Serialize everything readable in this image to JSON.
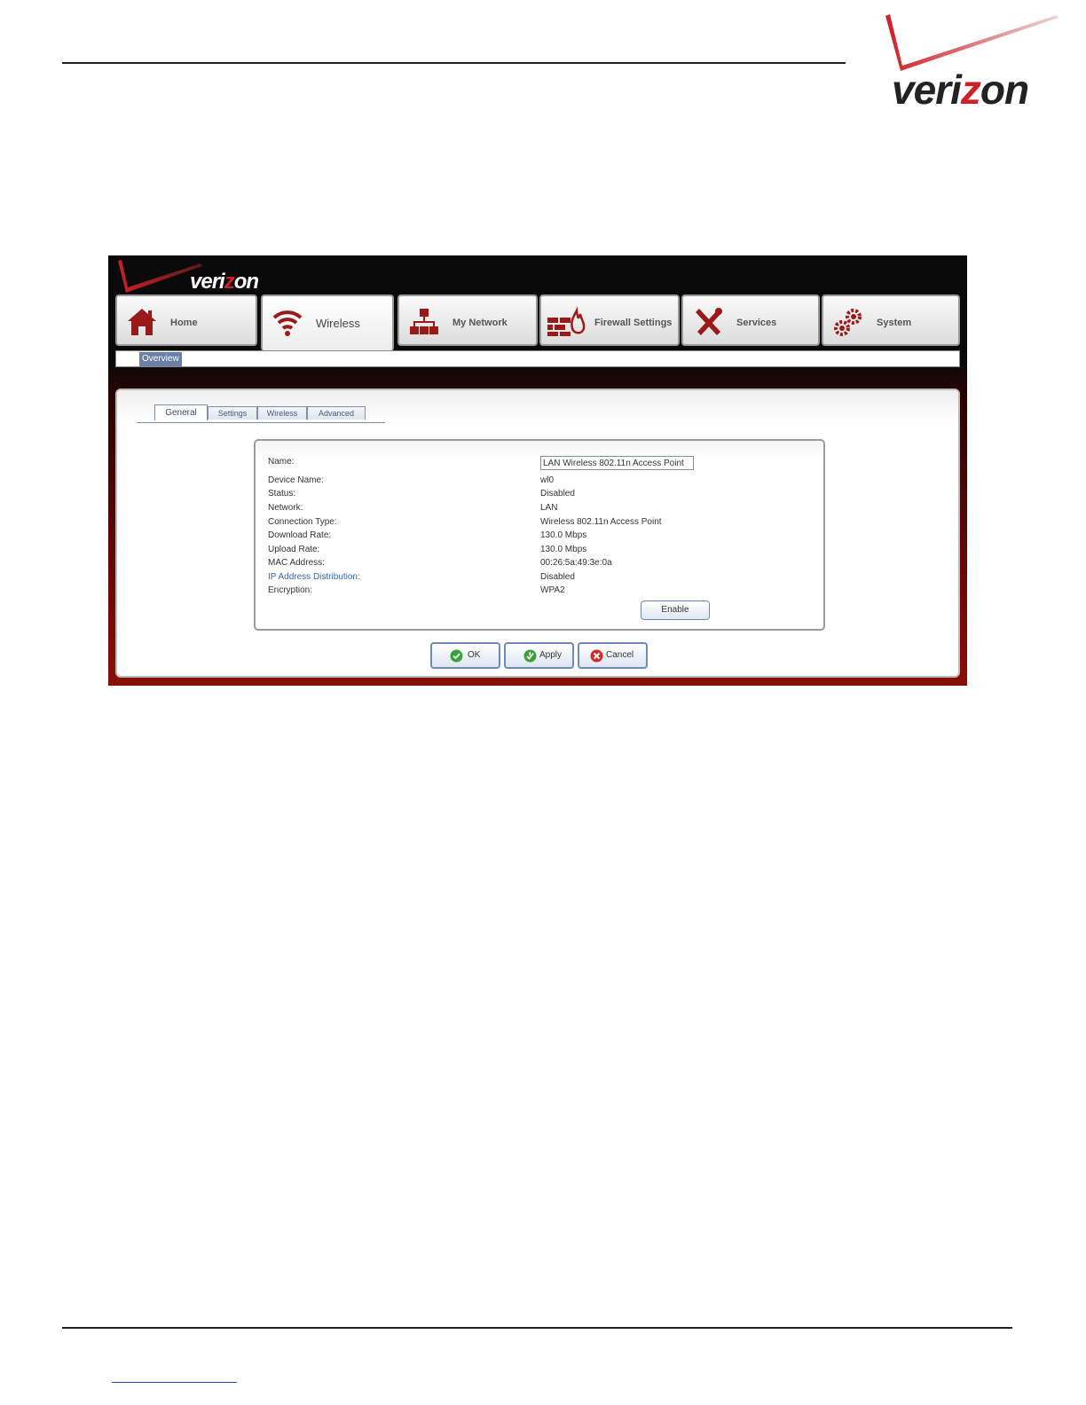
{
  "brand": {
    "name": "verizon",
    "parts": [
      "veri",
      "z",
      "on"
    ],
    "accent": "#cd2027",
    "dark": "#222222"
  },
  "app": {
    "logo_parts": [
      "veri",
      "z",
      "on"
    ],
    "nav": [
      {
        "label": "Home",
        "icon": "home-icon",
        "active": false
      },
      {
        "label": "Wireless",
        "icon": "wifi-icon",
        "active": true
      },
      {
        "label": "My Network",
        "icon": "network-icon",
        "active": false
      },
      {
        "label": "Firewall Settings",
        "icon": "firewall-icon",
        "active": false
      },
      {
        "label": "Services",
        "icon": "tools-icon",
        "active": false
      },
      {
        "label": "System",
        "icon": "gears-icon",
        "active": false
      }
    ],
    "subnav": {
      "overview": "Overview"
    },
    "tabs": {
      "general": "General",
      "settings": "Settings",
      "wireless": "Wireless",
      "advanced": "Advanced",
      "active": "General"
    },
    "info": {
      "name_label": "Name:",
      "name_value": "LAN Wireless 802.11n Access Point",
      "rows": [
        {
          "key": "Device Name:",
          "value": "wl0"
        },
        {
          "key": "Status:",
          "value": "Disabled"
        },
        {
          "key": "Network:",
          "value": "LAN"
        },
        {
          "key": "Connection Type:",
          "value": "Wireless 802.11n Access Point"
        },
        {
          "key": "Download Rate:",
          "value": "130.0 Mbps"
        },
        {
          "key": "Upload Rate:",
          "value": "130.0 Mbps"
        },
        {
          "key": "MAC Address:",
          "value": "00:26:5a:49:3e:0a"
        },
        {
          "key": "IP Address Distribution:",
          "value": "Disabled"
        },
        {
          "key": "Encryption:",
          "value": "WPA2"
        }
      ],
      "enable_label": "Enable"
    },
    "buttons": {
      "ok": "OK",
      "apply": "Apply",
      "cancel": "Cancel"
    },
    "colors": {
      "icon_red": "#9a1a1a",
      "link_blue": "#3a62b4",
      "ok_green": "#3aa03a",
      "cancel_red": "#d42a2a"
    }
  }
}
